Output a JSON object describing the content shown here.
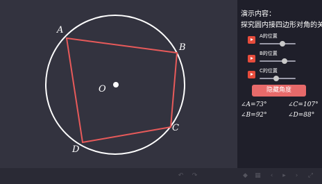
{
  "canvas": {
    "vertices": {
      "A": "A",
      "B": "B",
      "C": "C",
      "D": "D"
    },
    "center_label": "O",
    "colors": {
      "circle": "#ffffff",
      "quad": "#e85a5a",
      "background": "#33333f"
    }
  },
  "panel": {
    "title_line1": "演示内容：",
    "title_line2": "探究圆内接四边形对角的关",
    "controls": [
      {
        "label": "A的位置",
        "value": 0.65
      },
      {
        "label": "B的位置",
        "value": 0.72
      },
      {
        "label": "C的位置",
        "value": 0.45
      }
    ],
    "hide_button": "隐藏角度",
    "angles": {
      "A": "∠A=73°",
      "C": "∠C=107°",
      "B": "∠B=92°",
      "D": "∠D=88°"
    }
  },
  "toolbar": {
    "icons": [
      "undo-icon",
      "redo-icon",
      "shape-icon",
      "grid-icon",
      "prev-icon",
      "play-icon",
      "next-icon",
      "expand-icon"
    ]
  }
}
